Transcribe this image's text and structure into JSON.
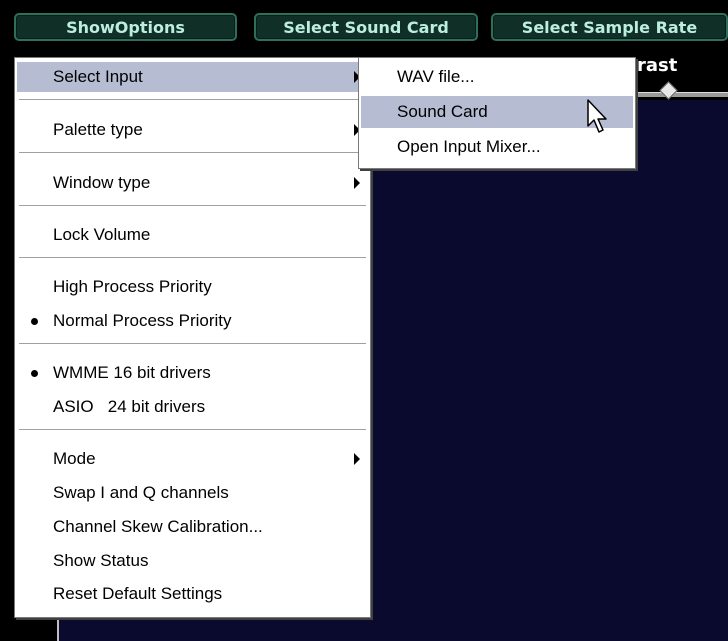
{
  "toolbar": {
    "show_options": "ShowOptions",
    "select_sound_card": "Select Sound Card",
    "select_sample_rate": "Select Sample Rate"
  },
  "background": {
    "contrast_label": "rast"
  },
  "main_menu": [
    {
      "label": "Select Input",
      "submenu": true,
      "selected": true
    },
    {
      "label": "Palette type",
      "submenu": true
    },
    {
      "label": "Window type",
      "submenu": true
    },
    {
      "label": "Lock Volume"
    },
    {
      "label": "High Process Priority"
    },
    {
      "label": "Normal Process Priority",
      "checked": true
    },
    {
      "label": "WMME 16 bit drivers",
      "checked": true
    },
    {
      "label": "ASIO   24 bit drivers"
    },
    {
      "label": "Mode",
      "submenu": true
    },
    {
      "label": "Swap I and Q channels"
    },
    {
      "label": "Channel Skew Calibration..."
    },
    {
      "label": "Show Status"
    },
    {
      "label": "Reset Default Settings"
    }
  ],
  "submenu": [
    {
      "label": "WAV file..."
    },
    {
      "label": "Sound Card",
      "selected": true
    },
    {
      "label": "Open Input Mixer..."
    }
  ],
  "colors": {
    "menu_highlight": "#b6bdd2",
    "toolbar_text": "#bdeedd",
    "panel_bg": "#0a0a2e"
  }
}
